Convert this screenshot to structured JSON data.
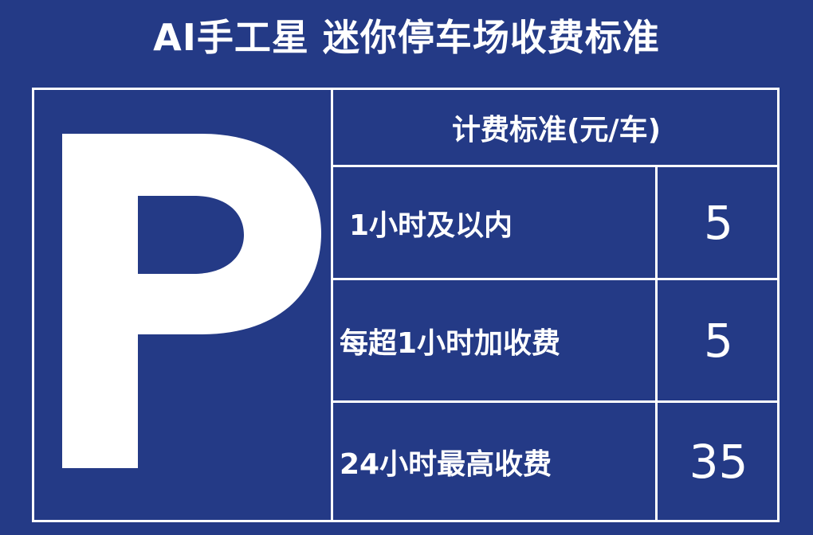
{
  "title": "AI手工星 迷你停车场收费标准",
  "sign": {
    "symbol": "P",
    "header": "计费标准(元/车)",
    "rows": [
      {
        "label": "1小时及以内",
        "price": "5"
      },
      {
        "label": "每超1小时加收费",
        "price": "5"
      },
      {
        "label": "24小时最高收费",
        "price": "35"
      }
    ]
  },
  "colors": {
    "background": "#243a86",
    "foreground": "#ffffff"
  }
}
